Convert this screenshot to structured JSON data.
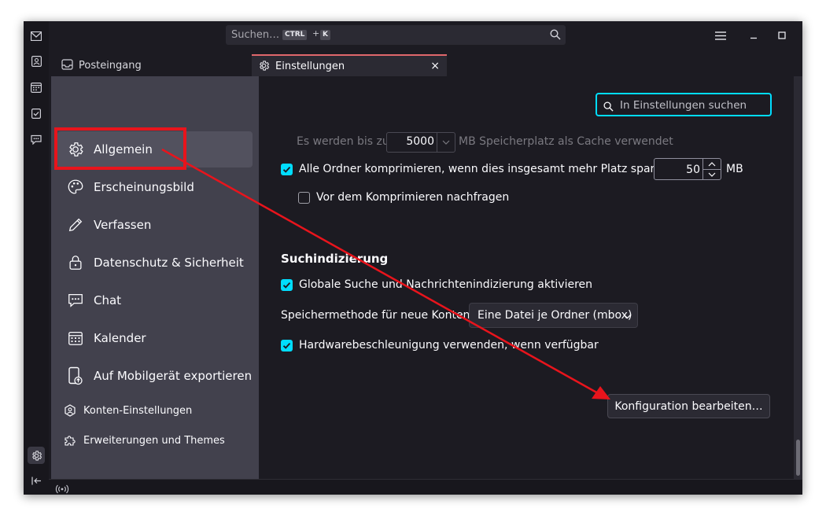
{
  "titlebar": {
    "search_placeholder": "Suchen…",
    "shortcut_key1": "CTRL",
    "shortcut_plus": "+",
    "shortcut_key2": "K"
  },
  "tabs": [
    {
      "label": "Posteingang",
      "icon": "inbox-icon"
    },
    {
      "label": "Einstellungen",
      "icon": "gear-icon",
      "close": "×"
    }
  ],
  "sidebar": {
    "categories": [
      {
        "label": "Allgemein",
        "icon": "gear-icon"
      },
      {
        "label": "Erscheinungsbild",
        "icon": "palette-icon"
      },
      {
        "label": "Verfassen",
        "icon": "pencil-icon"
      },
      {
        "label": "Datenschutz & Sicherheit",
        "icon": "lock-icon"
      },
      {
        "label": "Chat",
        "icon": "chat-icon"
      },
      {
        "label": "Kalender",
        "icon": "calendar-icon"
      },
      {
        "label": "Auf Mobilgerät exportieren",
        "icon": "mobile-export-icon"
      }
    ],
    "footer_items": [
      {
        "label": "Konten-Einstellungen",
        "icon": "account-icon"
      },
      {
        "label": "Erweiterungen und Themes",
        "icon": "puzzle-icon"
      }
    ]
  },
  "settings": {
    "search_placeholder": "In Einstellungen suchen",
    "cache_line_before": "Es werden bis zu",
    "cache_value": "5000",
    "cache_line_after": "MB Speicherplatz als Cache verwendet",
    "compact": {
      "label": "Alle Ordner komprimieren, wenn dies insgesamt mehr Platz spart als",
      "checked": true,
      "value": "50",
      "unit": "MB"
    },
    "compact_ask": {
      "label": "Vor dem Komprimieren nachfragen",
      "checked": false
    },
    "indexing_heading": "Suchindizierung",
    "global_search": {
      "label": "Globale Suche und Nachrichtenindizierung aktivieren",
      "checked": true
    },
    "store_type": {
      "label": "Speichermethode für neue Konten:",
      "value": "Eine Datei je Ordner (mbox)"
    },
    "hw_accel": {
      "label": "Hardwarebeschleunigung verwenden, wenn verfügbar",
      "checked": true
    },
    "config_button": "Konfiguration bearbeiten…"
  },
  "colors": {
    "accent": "#00ddff",
    "annotation": "#e8141c",
    "sidebar_bg": "#42414d",
    "content_bg": "#1c1b22"
  }
}
